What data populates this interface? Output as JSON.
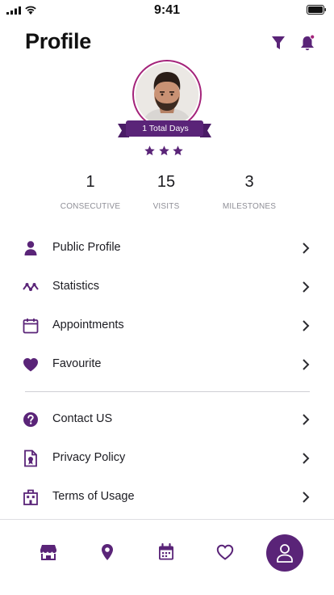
{
  "status_bar": {
    "time": "9:41"
  },
  "header": {
    "title": "Profile",
    "filter_icon": "filter-icon",
    "bell_icon": "bell-icon"
  },
  "profile": {
    "badge_label": "1 Total Days",
    "stars": 3
  },
  "stats": [
    {
      "value": "1",
      "label": "CONSECUTIVE"
    },
    {
      "value": "15",
      "label": "VISITS"
    },
    {
      "value": "3",
      "label": "MILESTONES"
    }
  ],
  "menu": [
    {
      "label": "Public Profile",
      "icon": "person-icon"
    },
    {
      "label": "Statistics",
      "icon": "activity-icon"
    },
    {
      "label": "Appointments",
      "icon": "calendar-icon"
    },
    {
      "label": "Favourite",
      "icon": "heart-icon"
    }
  ],
  "menu_secondary": [
    {
      "label": "Contact US",
      "icon": "help-icon"
    },
    {
      "label": "Privacy Policy",
      "icon": "certificate-icon"
    },
    {
      "label": "Terms of Usage",
      "icon": "building-icon"
    }
  ],
  "tab_bar": {
    "items": [
      "store-icon",
      "location-pin-icon",
      "calendar-icon",
      "heart-icon",
      "user-icon"
    ],
    "active": "user-icon"
  },
  "colors": {
    "accent": "#5a2478",
    "ring": "#a4237a",
    "text": "#1b1b1f",
    "muted": "#8f8f97"
  }
}
